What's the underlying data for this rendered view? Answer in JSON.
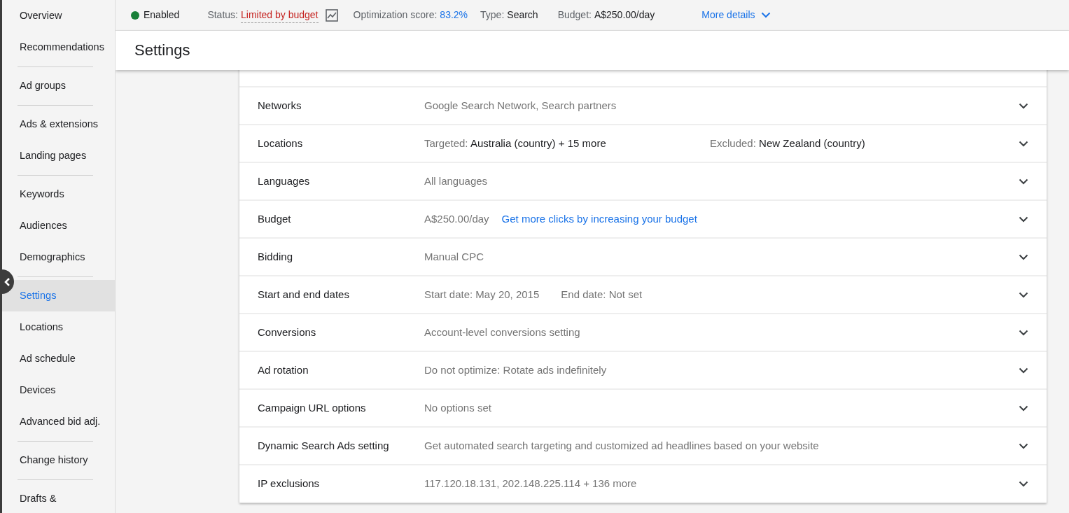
{
  "sidebar": {
    "groups": [
      [
        {
          "label": "Overview",
          "selected": false
        },
        {
          "label": "Recommendations",
          "selected": false
        }
      ],
      [
        {
          "label": "Ad groups",
          "selected": false
        }
      ],
      [
        {
          "label": "Ads & extensions",
          "selected": false
        },
        {
          "label": "Landing pages",
          "selected": false
        }
      ],
      [
        {
          "label": "Keywords",
          "selected": false
        },
        {
          "label": "Audiences",
          "selected": false
        },
        {
          "label": "Demographics",
          "selected": false
        }
      ],
      [
        {
          "label": "Settings",
          "selected": true
        },
        {
          "label": "Locations",
          "selected": false
        },
        {
          "label": "Ad schedule",
          "selected": false
        },
        {
          "label": "Devices",
          "selected": false
        },
        {
          "label": "Advanced bid adj.",
          "selected": false
        }
      ],
      [
        {
          "label": "Change history",
          "selected": false
        }
      ],
      [
        {
          "label": "Drafts &",
          "selected": false
        }
      ]
    ]
  },
  "summary_bar": {
    "status_dot": {
      "label": "Enabled",
      "color": "#188038"
    },
    "items": [
      {
        "kind": "status",
        "label": "Status:",
        "value": "Limited by budget"
      },
      {
        "kind": "score",
        "label": "Optimization score:",
        "value": "83.2%"
      },
      {
        "kind": "plain",
        "label": "Type:",
        "value": "Search"
      },
      {
        "kind": "plain",
        "label": "Budget:",
        "value": "A$250.00/day"
      }
    ],
    "more_link": "More details"
  },
  "page_title": "Settings",
  "settings": [
    {
      "name": "Networks",
      "parts": [
        {
          "kind": "text",
          "text": "Google Search Network, Search partners"
        }
      ]
    },
    {
      "name": "Locations",
      "parts": [
        {
          "kind": "pair",
          "label": "Targeted:",
          "value": "Australia (country) + 15 more"
        },
        {
          "kind": "pair",
          "label": "Excluded:",
          "value": "New Zealand (country)"
        }
      ]
    },
    {
      "name": "Languages",
      "parts": [
        {
          "kind": "text",
          "text": "All languages"
        }
      ]
    },
    {
      "name": "Budget",
      "parts": [
        {
          "kind": "text",
          "text": "A$250.00/day"
        },
        {
          "kind": "link",
          "text": "Get more clicks by increasing your budget"
        }
      ]
    },
    {
      "name": "Bidding",
      "parts": [
        {
          "kind": "text",
          "text": "Manual CPC"
        }
      ]
    },
    {
      "name": "Start and end dates",
      "parts": [
        {
          "kind": "text",
          "text": "Start date: May 20, 2015"
        },
        {
          "kind": "text",
          "text": "End date: Not set"
        }
      ]
    },
    {
      "name": "Conversions",
      "parts": [
        {
          "kind": "text",
          "text": "Account-level conversions setting"
        }
      ]
    },
    {
      "name": "Ad rotation",
      "parts": [
        {
          "kind": "text",
          "text": "Do not optimize: Rotate ads indefinitely"
        }
      ]
    },
    {
      "name": "Campaign URL options",
      "parts": [
        {
          "kind": "text",
          "text": "No options set"
        }
      ]
    },
    {
      "name": "Dynamic Search Ads setting",
      "parts": [
        {
          "kind": "text",
          "text": "Get automated search targeting and customized ad headlines based on your website"
        }
      ]
    },
    {
      "name": "IP exclusions",
      "parts": [
        {
          "kind": "text",
          "text": "117.120.18.131, 202.148.225.114 + 136 more"
        }
      ]
    }
  ]
}
